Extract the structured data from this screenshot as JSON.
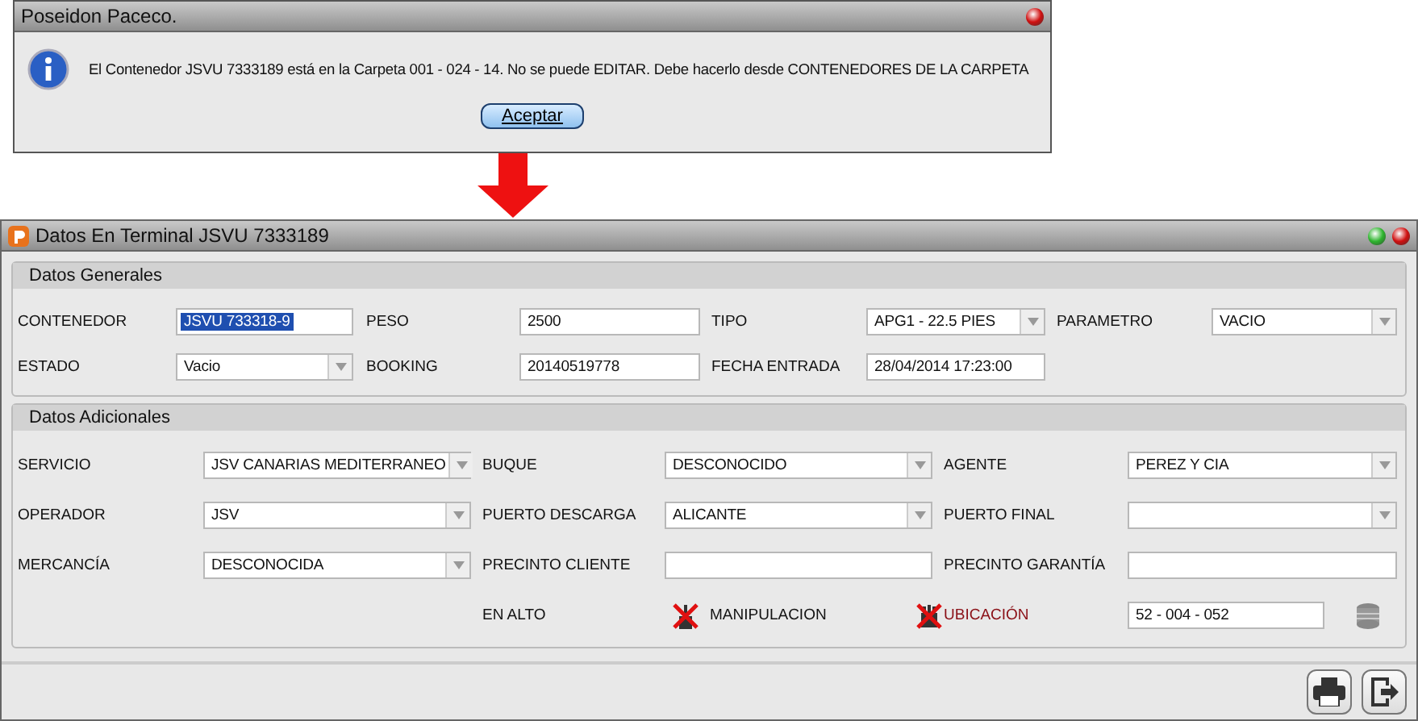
{
  "dialog": {
    "title": "Poseidon Paceco.",
    "message": "El Contenedor JSVU 7333189 está en la Carpeta 001 - 024 - 14. No se puede EDITAR. Debe hacerlo desde CONTENEDORES DE LA CARPETA",
    "button": "Aceptar"
  },
  "window": {
    "title": "Datos En Terminal JSVU 7333189"
  },
  "generales": {
    "title": "Datos Generales",
    "fields": [
      {
        "label": "CONTENEDOR",
        "value": "JSVU 733318-9",
        "kind": "text",
        "text_selected": true
      },
      {
        "label": "PESO",
        "value": "2500",
        "kind": "text",
        "text_selected": false
      },
      {
        "label": "TIPO",
        "value": "APG1 - 22.5 PIES",
        "kind": "select",
        "text_selected": false
      },
      {
        "label": "PARAMETRO",
        "value": "VACIO",
        "kind": "select",
        "text_selected": false
      },
      {
        "label": "ESTADO",
        "value": "Vacio",
        "kind": "select",
        "text_selected": false
      },
      {
        "label": "BOOKING",
        "value": "20140519778",
        "kind": "text",
        "text_selected": false
      },
      {
        "label": "FECHA ENTRADA",
        "value": "28/04/2014 17:23:00",
        "kind": "text",
        "text_selected": false
      }
    ]
  },
  "adicionales": {
    "title": "Datos Adicionales",
    "fields": [
      {
        "label": "SERVICIO",
        "value": "JSV CANARIAS MEDITERRANEO",
        "kind": "select"
      },
      {
        "label": "BUQUE",
        "value": "DESCONOCIDO",
        "kind": "select"
      },
      {
        "label": "AGENTE",
        "value": "PEREZ Y CIA",
        "kind": "select"
      },
      {
        "label": "OPERADOR",
        "value": "JSV",
        "kind": "select"
      },
      {
        "label": "PUERTO DESCARGA",
        "value": "ALICANTE",
        "kind": "select"
      },
      {
        "label": "PUERTO FINAL",
        "kind": "select"
      },
      {
        "label": "MERCANCÍA",
        "value": "DESCONOCIDA",
        "kind": "select"
      },
      {
        "label": "PRECINTO CLIENTE",
        "kind": "text"
      },
      {
        "label": "PRECINTO GARANTÍA",
        "kind": "text"
      }
    ],
    "status": {
      "en_alto": "EN ALTO",
      "flags": [
        {
          "label": "MANIPULACION",
          "alert": false
        },
        {
          "label": "UBICACIÓN",
          "alert": true
        }
      ],
      "ubicacion_value": "52 - 004 - 052"
    }
  }
}
